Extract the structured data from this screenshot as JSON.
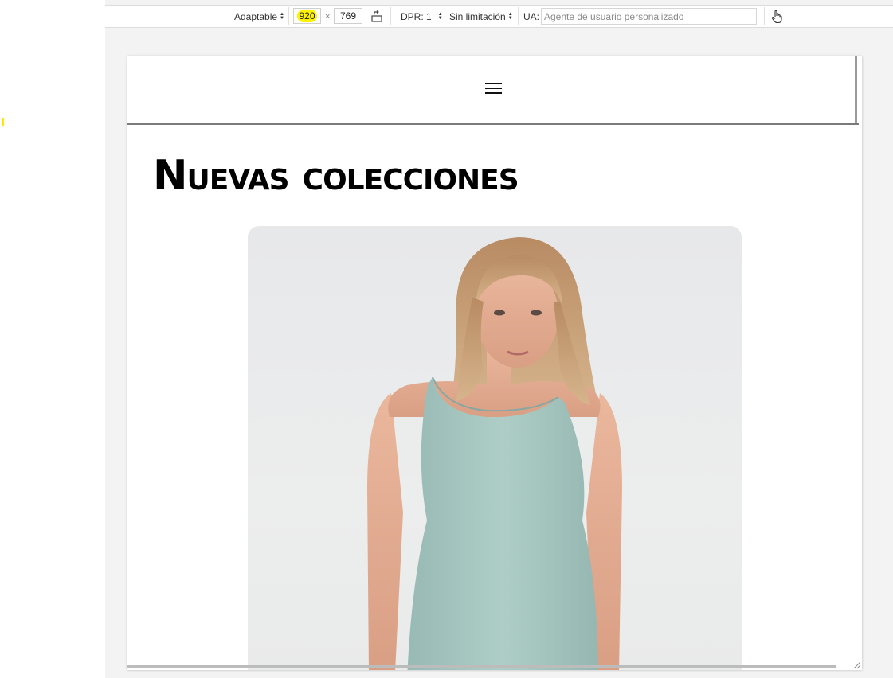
{
  "toolbar": {
    "device_mode": "Adaptable",
    "width": "920",
    "times": "×",
    "height": "769",
    "dpr": "DPR: 1",
    "throttling": "Sin limitación",
    "ua_label": "UA:",
    "ua_placeholder": "Agente de usuario personalizado"
  },
  "page": {
    "headline": "Nuevas colecciones"
  },
  "colors": {
    "highlight": "#fff200",
    "dress": "#a9c9c3",
    "background": "#f3f3f3"
  }
}
